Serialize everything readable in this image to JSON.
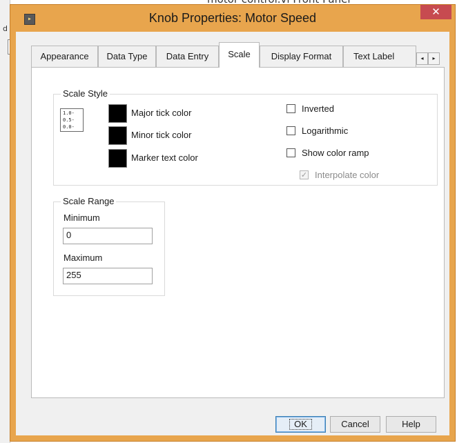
{
  "background_window": {
    "side_letter": "d",
    "title_fragment": "motor control.vi Front Panel"
  },
  "window": {
    "title": "Knob Properties: Motor Speed",
    "icon": "labview-vi-icon",
    "close_label": "✕"
  },
  "tabs": [
    {
      "label": "Appearance",
      "active": false
    },
    {
      "label": "Data Type",
      "active": false
    },
    {
      "label": "Data Entry",
      "active": false
    },
    {
      "label": "Scale",
      "active": true
    },
    {
      "label": "Display Format",
      "active": false
    },
    {
      "label": "Text Label",
      "active": false
    }
  ],
  "tab_scroll": {
    "left": "◂",
    "right": "▸"
  },
  "scale_style": {
    "group_label": "Scale Style",
    "preview_icon": {
      "lines": [
        "1.0-",
        "0.5-",
        "0.0-"
      ]
    },
    "colors": [
      {
        "label": "Major tick color",
        "color": "#000000"
      },
      {
        "label": "Minor tick color",
        "color": "#000000"
      },
      {
        "label": "Marker text color",
        "color": "#000000"
      }
    ],
    "options": [
      {
        "label": "Inverted",
        "checked": false,
        "enabled": true
      },
      {
        "label": "Logarithmic",
        "checked": false,
        "enabled": true
      },
      {
        "label": "Show color ramp",
        "checked": false,
        "enabled": true
      },
      {
        "label": "Interpolate color",
        "checked": true,
        "enabled": false
      }
    ]
  },
  "scale_range": {
    "group_label": "Scale Range",
    "minimum_label": "Minimum",
    "minimum_value": "0",
    "maximum_label": "Maximum",
    "maximum_value": "255"
  },
  "buttons": {
    "ok": "OK",
    "cancel": "Cancel",
    "help": "Help"
  },
  "colors": {
    "titlebar": "#e8a54d",
    "close": "#c74b50",
    "dialog_bg": "#f0f0f0"
  }
}
